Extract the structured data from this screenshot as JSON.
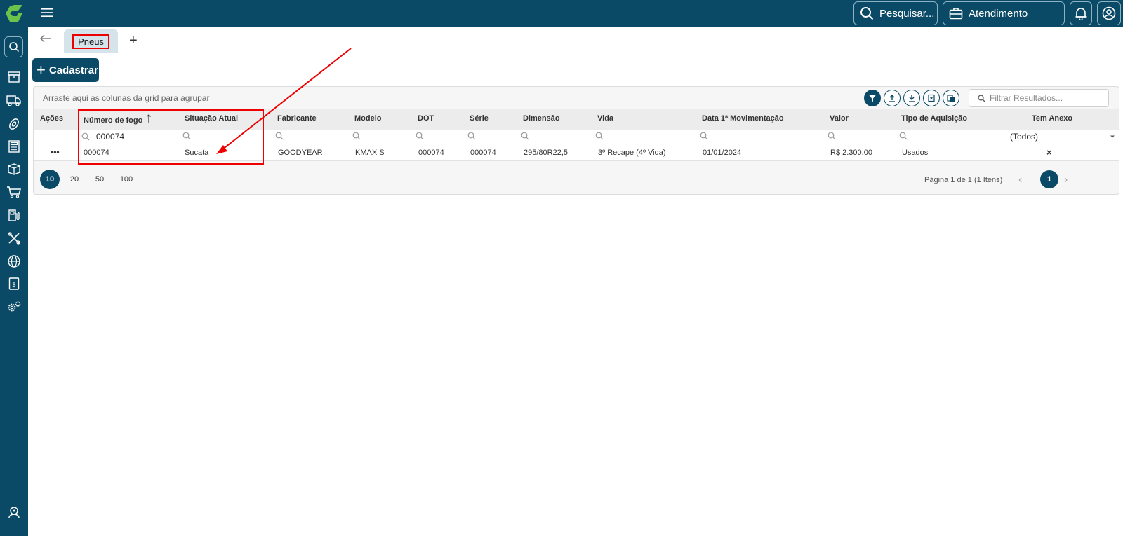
{
  "topbar": {
    "search_label": "Pesquisar...",
    "atendimento_label": "Atendimento"
  },
  "tabs": {
    "active_label": "Pneus",
    "add_label": "+"
  },
  "actions": {
    "cadastrar_label": "Cadastrar"
  },
  "grid": {
    "group_hint": "Arraste aqui as colunas da grid para agrupar",
    "filter_placeholder": "Filtrar Resultados...",
    "columns": {
      "acoes": "Ações",
      "numero_fogo": "Número de fogo",
      "situacao": "Situação Atual",
      "fabricante": "Fabricante",
      "modelo": "Modelo",
      "dot": "DOT",
      "serie": "Série",
      "dimensao": "Dimensão",
      "vida": "Vida",
      "data_mov": "Data 1ª Movimentação",
      "valor": "Valor",
      "tipo_aquisicao": "Tipo de Aquisição",
      "tem_anexo": "Tem Anexo"
    },
    "filters": {
      "numero_fogo": "000074",
      "tem_anexo": "(Todos)"
    },
    "row": {
      "acoes": "•••",
      "numero_fogo": "000074",
      "situacao": "Sucata",
      "fabricante": "GOODYEAR",
      "modelo": "KMAX S",
      "dot": "000074",
      "serie": "000074",
      "dimensao": "295/80R22,5",
      "vida": "3º Recape (4º Vida)",
      "data_mov": "01/01/2024",
      "valor": "R$ 2.300,00",
      "tipo_aquisicao": "Usados",
      "tem_anexo": "×"
    }
  },
  "pager": {
    "sizes": [
      "10",
      "20",
      "50",
      "100"
    ],
    "active_size": "10",
    "info": "Página 1 de 1 (1 Itens)",
    "current_page": "1"
  },
  "colors": {
    "primary": "#0b4a66",
    "highlight": "#ee0000"
  }
}
